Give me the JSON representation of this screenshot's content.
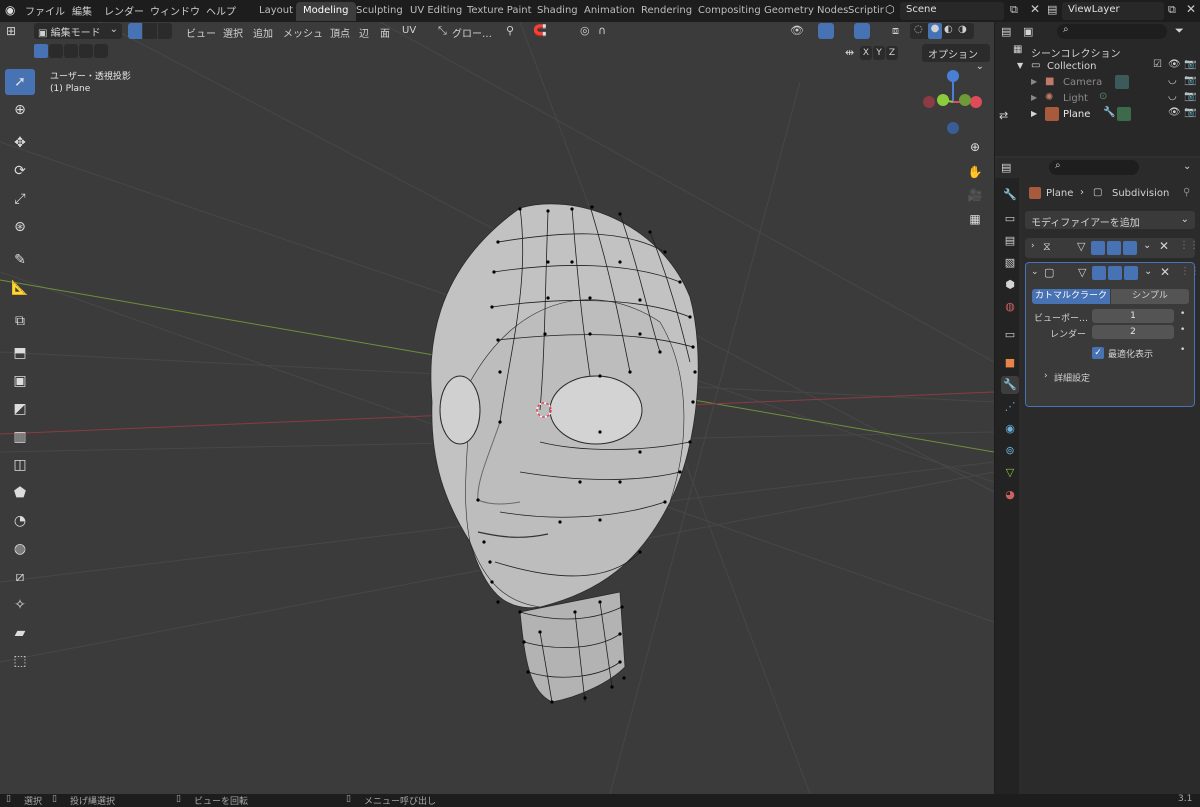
{
  "menu": [
    "ファイル",
    "編集",
    "レンダー",
    "ウィンドウ",
    "ヘルプ"
  ],
  "workspaces": [
    "Layout",
    "Modeling",
    "Sculpting",
    "UV Editing",
    "Texture Paint",
    "Shading",
    "Animation",
    "Rendering",
    "Compositing",
    "Geometry Nodes",
    "Scriptir"
  ],
  "active_workspace": "Modeling",
  "scene": "Scene",
  "view_layer": "ViewLayer",
  "viewport_header": {
    "mode": "編集モード",
    "menus": [
      "ビュー",
      "選択",
      "追加",
      "メッシュ",
      "頂点",
      "辺",
      "面",
      "UV"
    ],
    "transform": "グロー…",
    "options": "オプション",
    "axes": [
      "X",
      "Y",
      "Z"
    ]
  },
  "viewport": {
    "view_name": "ユーザー・透視投影",
    "object_name": "(1) Plane"
  },
  "outliner": {
    "title": "シーンコレクション",
    "collection": "Collection",
    "items": [
      "Camera",
      "Light",
      "Plane"
    ]
  },
  "properties": {
    "breadcrumb_object": "Plane",
    "breadcrumb_modifier": "Subdivision",
    "add_modifier": "モディファイアーを追加",
    "subdiv_tabs": [
      "カトマルクラーク",
      "シンプル"
    ],
    "viewport_label": "ビューポー…",
    "viewport_value": "1",
    "render_label": "レンダー",
    "render_value": "2",
    "optimal_display": "最適化表示",
    "advanced": "詳細設定"
  },
  "status": {
    "select": "選択",
    "lasso": "投げ縄選択",
    "rotate": "ビューを回転",
    "menu": "メニュー呼び出し",
    "version": "3.1"
  },
  "colors": {
    "accent": "#4772b3",
    "x_axis": "#e04b59",
    "y_axis": "#8bcb3c",
    "z_axis": "#4a7fd6"
  }
}
